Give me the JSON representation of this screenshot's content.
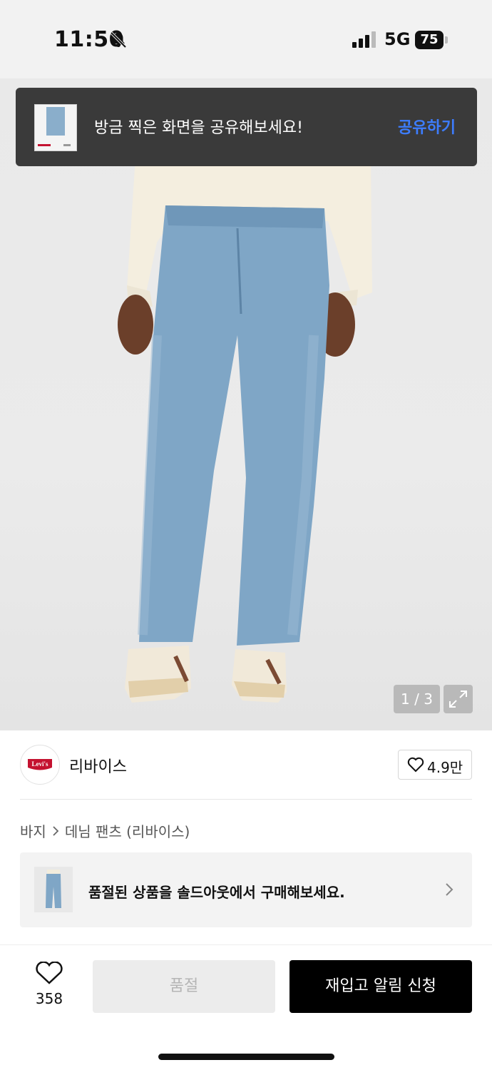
{
  "status_bar": {
    "time": "11:50",
    "network": "5G",
    "battery": "75"
  },
  "toast": {
    "message": "방금 찍은 화면을 공유해보세요!",
    "action": "공유하기",
    "action_color": "#3d7dff"
  },
  "gallery": {
    "counter": "1 / 3"
  },
  "brand": {
    "name": "리바이스",
    "logo_text": "Levi's",
    "like_count": "4.9만"
  },
  "breadcrumb": {
    "items": [
      "바지",
      "데님 팬츠 (리바이스)"
    ]
  },
  "soldout_banner": {
    "text": "품절된 상품을 솔드아웃에서 구매해보세요."
  },
  "bottom_bar": {
    "wish_count": "358",
    "soldout_label": "품절",
    "restock_label": "재입고 알림 신청"
  },
  "colors": {
    "brand_red": "#c41230",
    "primary_black": "#000000"
  }
}
